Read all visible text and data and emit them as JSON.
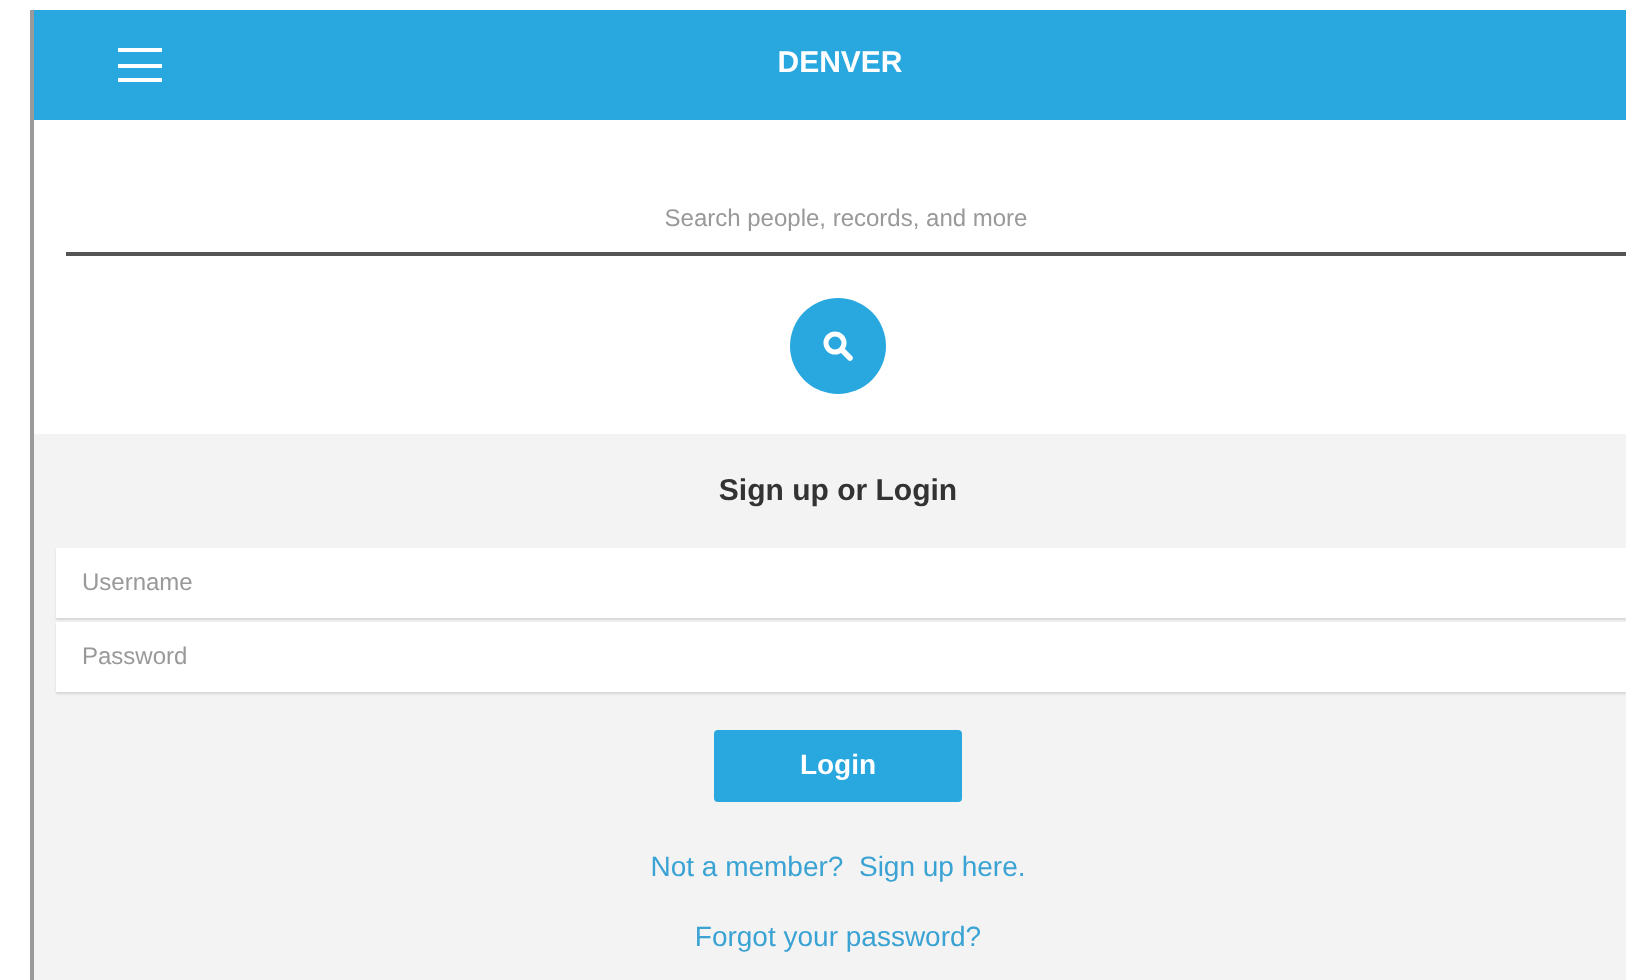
{
  "header": {
    "title": "DENVER"
  },
  "search": {
    "placeholder": "Search people, records, and more"
  },
  "login": {
    "heading": "Sign up or Login",
    "fields": [
      {
        "placeholder": "Username"
      },
      {
        "placeholder": "Password"
      }
    ],
    "button": "Login",
    "links": [
      "Not a member?  Sign up here.",
      "Forgot your password?"
    ]
  }
}
